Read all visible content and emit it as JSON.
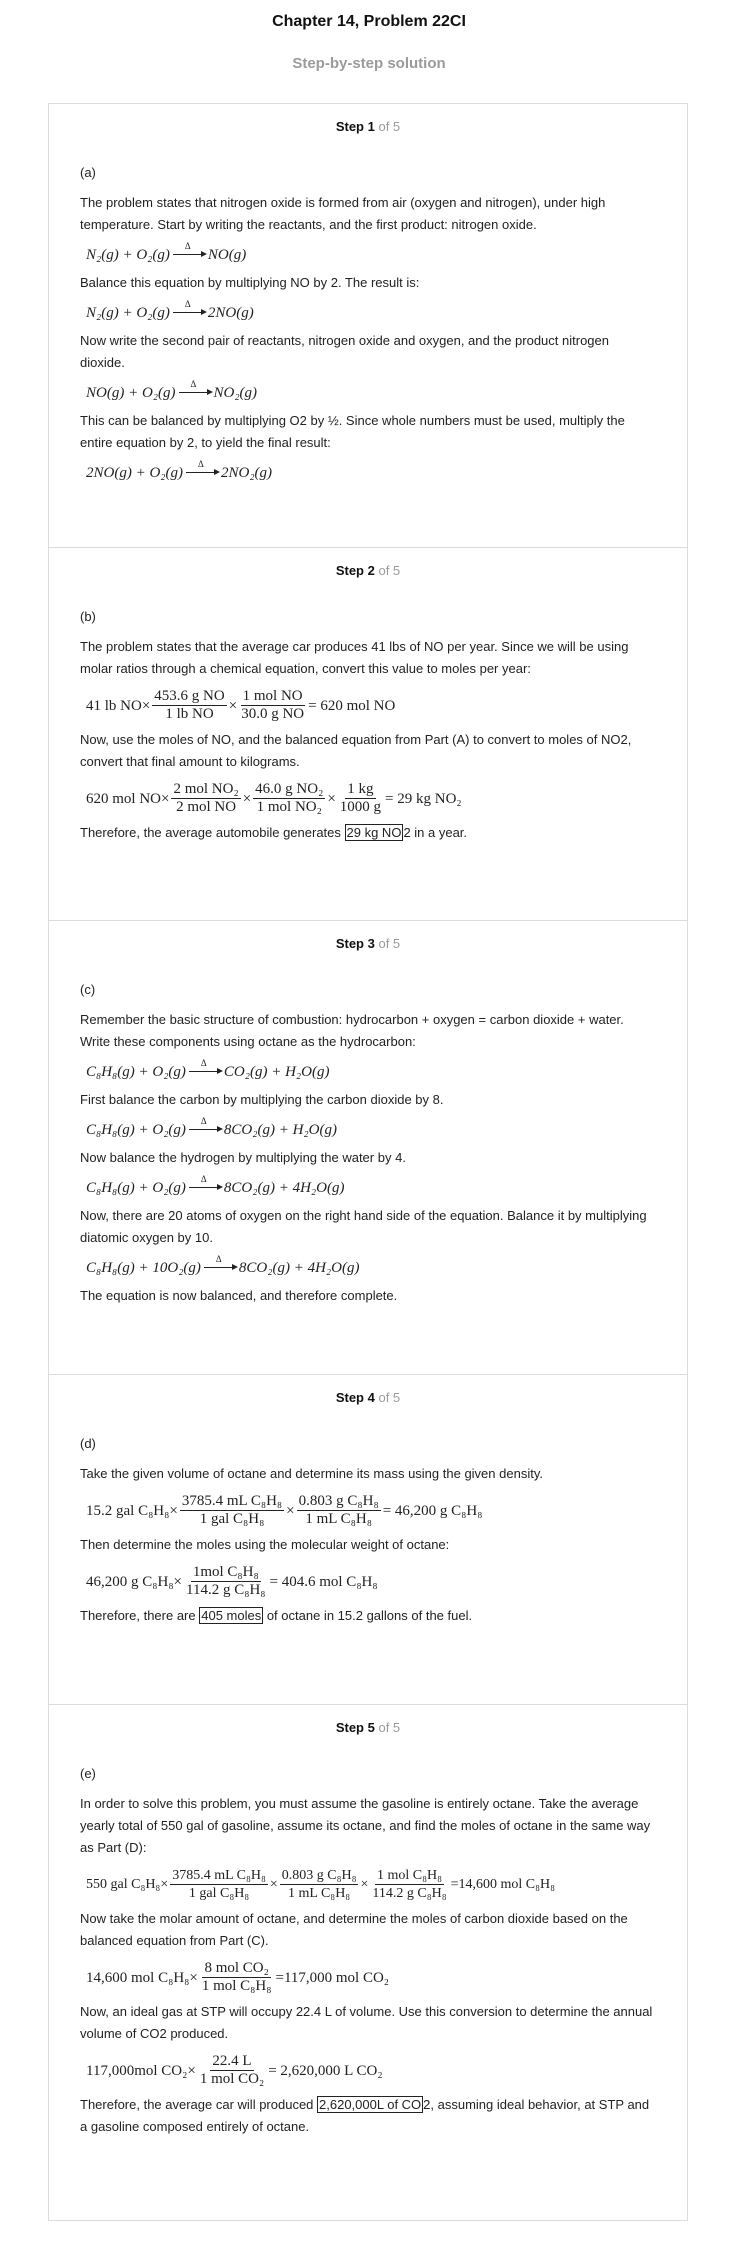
{
  "header": {
    "title": "Chapter 14, Problem 22CI",
    "subtitle": "Step-by-step solution"
  },
  "steps": [
    {
      "head": {
        "label": "Step 1",
        "of": "of 5"
      },
      "part": "(a)",
      "p1": "The problem states that nitrogen oxide is formed from air (oxygen and nitrogen), under high temperature. Start by writing the reactants, and the first product: nitrogen oxide.",
      "p2": "Balance this equation by multiplying NO by 2. The result is:",
      "p3": "Now write the second pair of reactants, nitrogen oxide and oxygen, and the product nitrogen dioxide.",
      "p4": "This can be balanced by multiplying O2 by ½. Since whole numbers must be used, multiply the entire equation by 2, to yield the final result:"
    },
    {
      "head": {
        "label": "Step 2",
        "of": "of 5"
      },
      "part": "(b)",
      "p1": "The problem states that the average car produces 41 lbs of NO per year. Since we will be using molar ratios through a chemical equation, convert this value to moles per year:",
      "p2": "Now, use the moles of NO, and the balanced equation from Part (A) to convert to moles of NO2, convert that final amount to kilograms.",
      "p3_pre": "Therefore, the average automobile generates ",
      "p3_box": "29 kg NO",
      "p3_post": "2 in a year."
    },
    {
      "head": {
        "label": "Step 3",
        "of": "of 5"
      },
      "part": "(c)",
      "p1": "Remember the basic structure of combustion: hydrocarbon + oxygen = carbon dioxide + water. Write these components using octane as the hydrocarbon:",
      "p2": "First balance the carbon by multiplying the carbon dioxide by 8.",
      "p3": "Now balance the hydrogen by multiplying the water by 4.",
      "p4": "Now, there are 20 atoms of oxygen on the right hand side of the equation. Balance it by multiplying diatomic oxygen by 10.",
      "p5": "The equation is now balanced, and therefore complete."
    },
    {
      "head": {
        "label": "Step 4",
        "of": "of 5"
      },
      "part": "(d)",
      "p1": "Take the given volume of octane and determine its mass using the given density.",
      "p2": "Then determine the moles using the molecular weight of octane:",
      "p3_pre": "Therefore, there are ",
      "p3_box": "405 moles",
      "p3_post": " of octane in 15.2 gallons of the fuel."
    },
    {
      "head": {
        "label": "Step 5",
        "of": "of 5"
      },
      "part": "(e)",
      "p1": "In order to solve this problem, you must assume the gasoline is entirely octane. Take the average yearly total of 550 gal of gasoline, assume its octane, and find the moles of octane in the same way as Part (D):",
      "p2": "Now take the molar amount of octane, and determine the moles of carbon dioxide based on the balanced equation from Part (C).",
      "p3": "Now, an ideal gas at STP will occupy 22.4 L of volume. Use this conversion to determine the annual volume of CO2 produced.",
      "p4_pre": "Therefore, the average car will produced ",
      "p4_box": "2,620,000L of CO",
      "p4_post": "2, assuming ideal behavior, at STP and a gasoline composed entirely of octane."
    }
  ],
  "equations": {
    "s2_eq1": {
      "lead": "41 lb NO×",
      "f1n": "453.6 g NO",
      "f1d": "1 lb NO",
      "f2n": "1 mol NO",
      "f2d": "30.0 g NO",
      "res": "= 620 mol NO"
    },
    "s2_eq2": {
      "lead": "620 mol NO×",
      "f1n": "2 mol NO₂",
      "f1d": "2 mol NO",
      "f2n": "46.0 g NO₂",
      "f2d": "1 mol NO₂",
      "f3n": "1 kg",
      "f3d": "1000 g",
      "res": "= 29 kg NO₂"
    },
    "s4_eq1": {
      "lead": "15.2 gal C₈H₈×",
      "f1n": "3785.4 mL C₈H₈",
      "f1d": "1 gal C₈H₈",
      "f2n": "0.803 g C₈H₈",
      "f2d": "1 mL C₈H₈",
      "res": "= 46,200 g C₈H₈"
    },
    "s4_eq2": {
      "lead": "46,200 g C₈H₈×",
      "f1n": "1mol C₈H₈",
      "f1d": "114.2 g C₈H₈",
      "res": "= 404.6 mol C₈H₈"
    },
    "s5_eq1": {
      "lead": "550 gal C₈H₈×",
      "f1n": "3785.4 mL C₈H₈",
      "f1d": "1 gal C₈H₈",
      "f2n": "0.803 g C₈H₈",
      "f2d": "1 mL C₈H₈",
      "f3n": "1 mol C₈H₈",
      "f3d": "114.2 g C₈H₈",
      "res": "=14,600 mol C₈H₈"
    },
    "s5_eq2": {
      "lead": "14,600 mol C₈H₈×",
      "f1n": "8 mol CO₂",
      "f1d": "1 mol C₈H₈",
      "res": "=117,000 mol CO₂"
    },
    "s5_eq3": {
      "lead": "117,000mol CO₂×",
      "f1n": "22.4 L",
      "f1d": "1 mol CO₂",
      "res": "= 2,620,000 L CO₂"
    }
  },
  "reactions": {
    "delta": "Δ",
    "r1_l": "N₂(g) + O₂(g)",
    "r1_r": "NO(g)",
    "r2_l": "N₂(g) + O₂(g)",
    "r2_r": "2NO(g)",
    "r3_l": "NO(g) + O₂(g)",
    "r3_r": "NO₂(g)",
    "r4_l": "2NO(g) + O₂(g)",
    "r4_r": "2NO₂(g)",
    "r5_l": "C₈H₈(g) + O₂(g)",
    "r5_r": "CO₂(g) + H₂O(g)",
    "r6_l": "C₈H₈(g) + O₂(g)",
    "r6_r": "8CO₂(g) + H₂O(g)",
    "r7_l": "C₈H₈(g) + O₂(g)",
    "r7_r": "8CO₂(g) + 4H₂O(g)",
    "r8_l": "C₈H₈(g) + 10O₂(g)",
    "r8_r": "8CO₂(g) + 4H₂O(g)"
  }
}
